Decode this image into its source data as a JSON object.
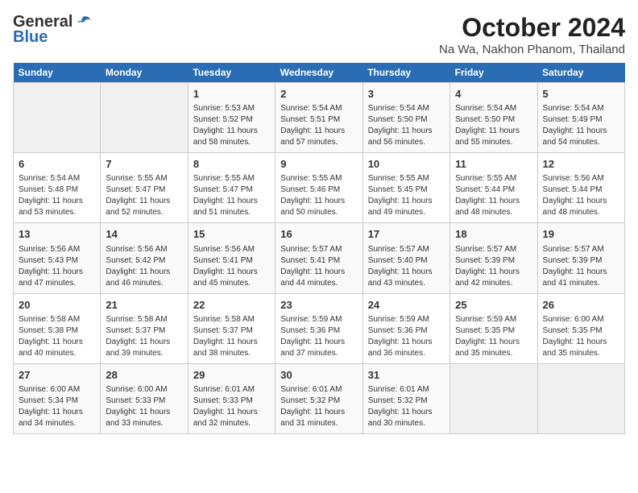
{
  "logo": {
    "general": "General",
    "blue": "Blue"
  },
  "title": "October 2024",
  "location": "Na Wa, Nakhon Phanom, Thailand",
  "days_of_week": [
    "Sunday",
    "Monday",
    "Tuesday",
    "Wednesday",
    "Thursday",
    "Friday",
    "Saturday"
  ],
  "weeks": [
    [
      {
        "day": "",
        "info": ""
      },
      {
        "day": "",
        "info": ""
      },
      {
        "day": "1",
        "info": "Sunrise: 5:53 AM\nSunset: 5:52 PM\nDaylight: 11 hours and 58 minutes."
      },
      {
        "day": "2",
        "info": "Sunrise: 5:54 AM\nSunset: 5:51 PM\nDaylight: 11 hours and 57 minutes."
      },
      {
        "day": "3",
        "info": "Sunrise: 5:54 AM\nSunset: 5:50 PM\nDaylight: 11 hours and 56 minutes."
      },
      {
        "day": "4",
        "info": "Sunrise: 5:54 AM\nSunset: 5:50 PM\nDaylight: 11 hours and 55 minutes."
      },
      {
        "day": "5",
        "info": "Sunrise: 5:54 AM\nSunset: 5:49 PM\nDaylight: 11 hours and 54 minutes."
      }
    ],
    [
      {
        "day": "6",
        "info": "Sunrise: 5:54 AM\nSunset: 5:48 PM\nDaylight: 11 hours and 53 minutes."
      },
      {
        "day": "7",
        "info": "Sunrise: 5:55 AM\nSunset: 5:47 PM\nDaylight: 11 hours and 52 minutes."
      },
      {
        "day": "8",
        "info": "Sunrise: 5:55 AM\nSunset: 5:47 PM\nDaylight: 11 hours and 51 minutes."
      },
      {
        "day": "9",
        "info": "Sunrise: 5:55 AM\nSunset: 5:46 PM\nDaylight: 11 hours and 50 minutes."
      },
      {
        "day": "10",
        "info": "Sunrise: 5:55 AM\nSunset: 5:45 PM\nDaylight: 11 hours and 49 minutes."
      },
      {
        "day": "11",
        "info": "Sunrise: 5:55 AM\nSunset: 5:44 PM\nDaylight: 11 hours and 48 minutes."
      },
      {
        "day": "12",
        "info": "Sunrise: 5:56 AM\nSunset: 5:44 PM\nDaylight: 11 hours and 48 minutes."
      }
    ],
    [
      {
        "day": "13",
        "info": "Sunrise: 5:56 AM\nSunset: 5:43 PM\nDaylight: 11 hours and 47 minutes."
      },
      {
        "day": "14",
        "info": "Sunrise: 5:56 AM\nSunset: 5:42 PM\nDaylight: 11 hours and 46 minutes."
      },
      {
        "day": "15",
        "info": "Sunrise: 5:56 AM\nSunset: 5:41 PM\nDaylight: 11 hours and 45 minutes."
      },
      {
        "day": "16",
        "info": "Sunrise: 5:57 AM\nSunset: 5:41 PM\nDaylight: 11 hours and 44 minutes."
      },
      {
        "day": "17",
        "info": "Sunrise: 5:57 AM\nSunset: 5:40 PM\nDaylight: 11 hours and 43 minutes."
      },
      {
        "day": "18",
        "info": "Sunrise: 5:57 AM\nSunset: 5:39 PM\nDaylight: 11 hours and 42 minutes."
      },
      {
        "day": "19",
        "info": "Sunrise: 5:57 AM\nSunset: 5:39 PM\nDaylight: 11 hours and 41 minutes."
      }
    ],
    [
      {
        "day": "20",
        "info": "Sunrise: 5:58 AM\nSunset: 5:38 PM\nDaylight: 11 hours and 40 minutes."
      },
      {
        "day": "21",
        "info": "Sunrise: 5:58 AM\nSunset: 5:37 PM\nDaylight: 11 hours and 39 minutes."
      },
      {
        "day": "22",
        "info": "Sunrise: 5:58 AM\nSunset: 5:37 PM\nDaylight: 11 hours and 38 minutes."
      },
      {
        "day": "23",
        "info": "Sunrise: 5:59 AM\nSunset: 5:36 PM\nDaylight: 11 hours and 37 minutes."
      },
      {
        "day": "24",
        "info": "Sunrise: 5:59 AM\nSunset: 5:36 PM\nDaylight: 11 hours and 36 minutes."
      },
      {
        "day": "25",
        "info": "Sunrise: 5:59 AM\nSunset: 5:35 PM\nDaylight: 11 hours and 35 minutes."
      },
      {
        "day": "26",
        "info": "Sunrise: 6:00 AM\nSunset: 5:35 PM\nDaylight: 11 hours and 35 minutes."
      }
    ],
    [
      {
        "day": "27",
        "info": "Sunrise: 6:00 AM\nSunset: 5:34 PM\nDaylight: 11 hours and 34 minutes."
      },
      {
        "day": "28",
        "info": "Sunrise: 6:00 AM\nSunset: 5:33 PM\nDaylight: 11 hours and 33 minutes."
      },
      {
        "day": "29",
        "info": "Sunrise: 6:01 AM\nSunset: 5:33 PM\nDaylight: 11 hours and 32 minutes."
      },
      {
        "day": "30",
        "info": "Sunrise: 6:01 AM\nSunset: 5:32 PM\nDaylight: 11 hours and 31 minutes."
      },
      {
        "day": "31",
        "info": "Sunrise: 6:01 AM\nSunset: 5:32 PM\nDaylight: 11 hours and 30 minutes."
      },
      {
        "day": "",
        "info": ""
      },
      {
        "day": "",
        "info": ""
      }
    ]
  ]
}
